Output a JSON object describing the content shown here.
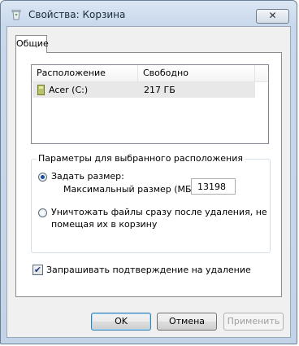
{
  "window": {
    "title": "Свойства: Корзина",
    "close_glyph": "✕"
  },
  "tabs": [
    {
      "label": "Общие",
      "selected": true
    }
  ],
  "locations": {
    "columns": [
      "Расположение корзины",
      "Свободно"
    ],
    "rows": [
      {
        "location": "Acer (C:)",
        "free": "217 ГБ",
        "icon": "drive-icon",
        "selected": true
      }
    ]
  },
  "settings": {
    "group_title": "Параметры для выбранного расположения",
    "custom_size_label": "Задать размер:",
    "max_size_label": "Максимальный размер (МБ):",
    "max_size_value": "13198",
    "no_recycle_label_line1": "Уничтожать файлы сразу после удаления, не",
    "no_recycle_label_line2": "помещая их в корзину",
    "selected_option": "custom_size"
  },
  "confirm": {
    "label": "Запрашивать подтверждение на удаление",
    "checked": true,
    "check_glyph": "✔"
  },
  "buttons": {
    "ok": "OK",
    "cancel": "Отмена",
    "apply": "Применить"
  },
  "colors": {
    "title_bar": "#c9d9ec",
    "selection_row": "#e8e8e8",
    "radio_dot": "#1a4f9c"
  }
}
